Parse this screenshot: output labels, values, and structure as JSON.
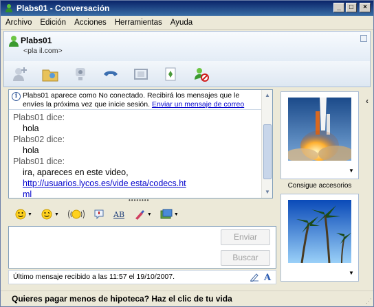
{
  "window": {
    "title": "Plabs01 - Conversación"
  },
  "menu": [
    "Archivo",
    "Edición",
    "Acciones",
    "Herramientas",
    "Ayuda"
  ],
  "contact": {
    "name": "Plabs01",
    "email": "<pla                    il.com>"
  },
  "info": {
    "text": "Plabs01 aparece como No conectado. Recibirá los mensajes que le envíes la próxima vez que inicie sesión.",
    "link": "Enviar un mensaje de correo"
  },
  "messages": [
    {
      "sender": "Plabs01 dice:",
      "text": "hola"
    },
    {
      "sender": "Plabs02 dice:",
      "text": "hola"
    },
    {
      "sender": "Plabs01 dice:",
      "text": "ira, apareces en este video,"
    }
  ],
  "link_lines": [
    "http://usuarios.lycos.es/vide                               esta/codecs.ht",
    "ml"
  ],
  "buttons": {
    "send": "Enviar",
    "search": "Buscar"
  },
  "status": "Último mensaje recibido a las 11:57 el 19/10/2007.",
  "side": {
    "accessories": "Consigue accesorios"
  },
  "ad": "Quieres pagar menos de hipoteca? Haz el clic de tu vida",
  "toolbar_icons": [
    "invite-icon",
    "send-files-icon",
    "webcam-icon",
    "call-icon",
    "activities-icon",
    "games-icon",
    "block-icon"
  ],
  "colors": {
    "titlebar": "#0a246a",
    "link": "#0000cc"
  }
}
